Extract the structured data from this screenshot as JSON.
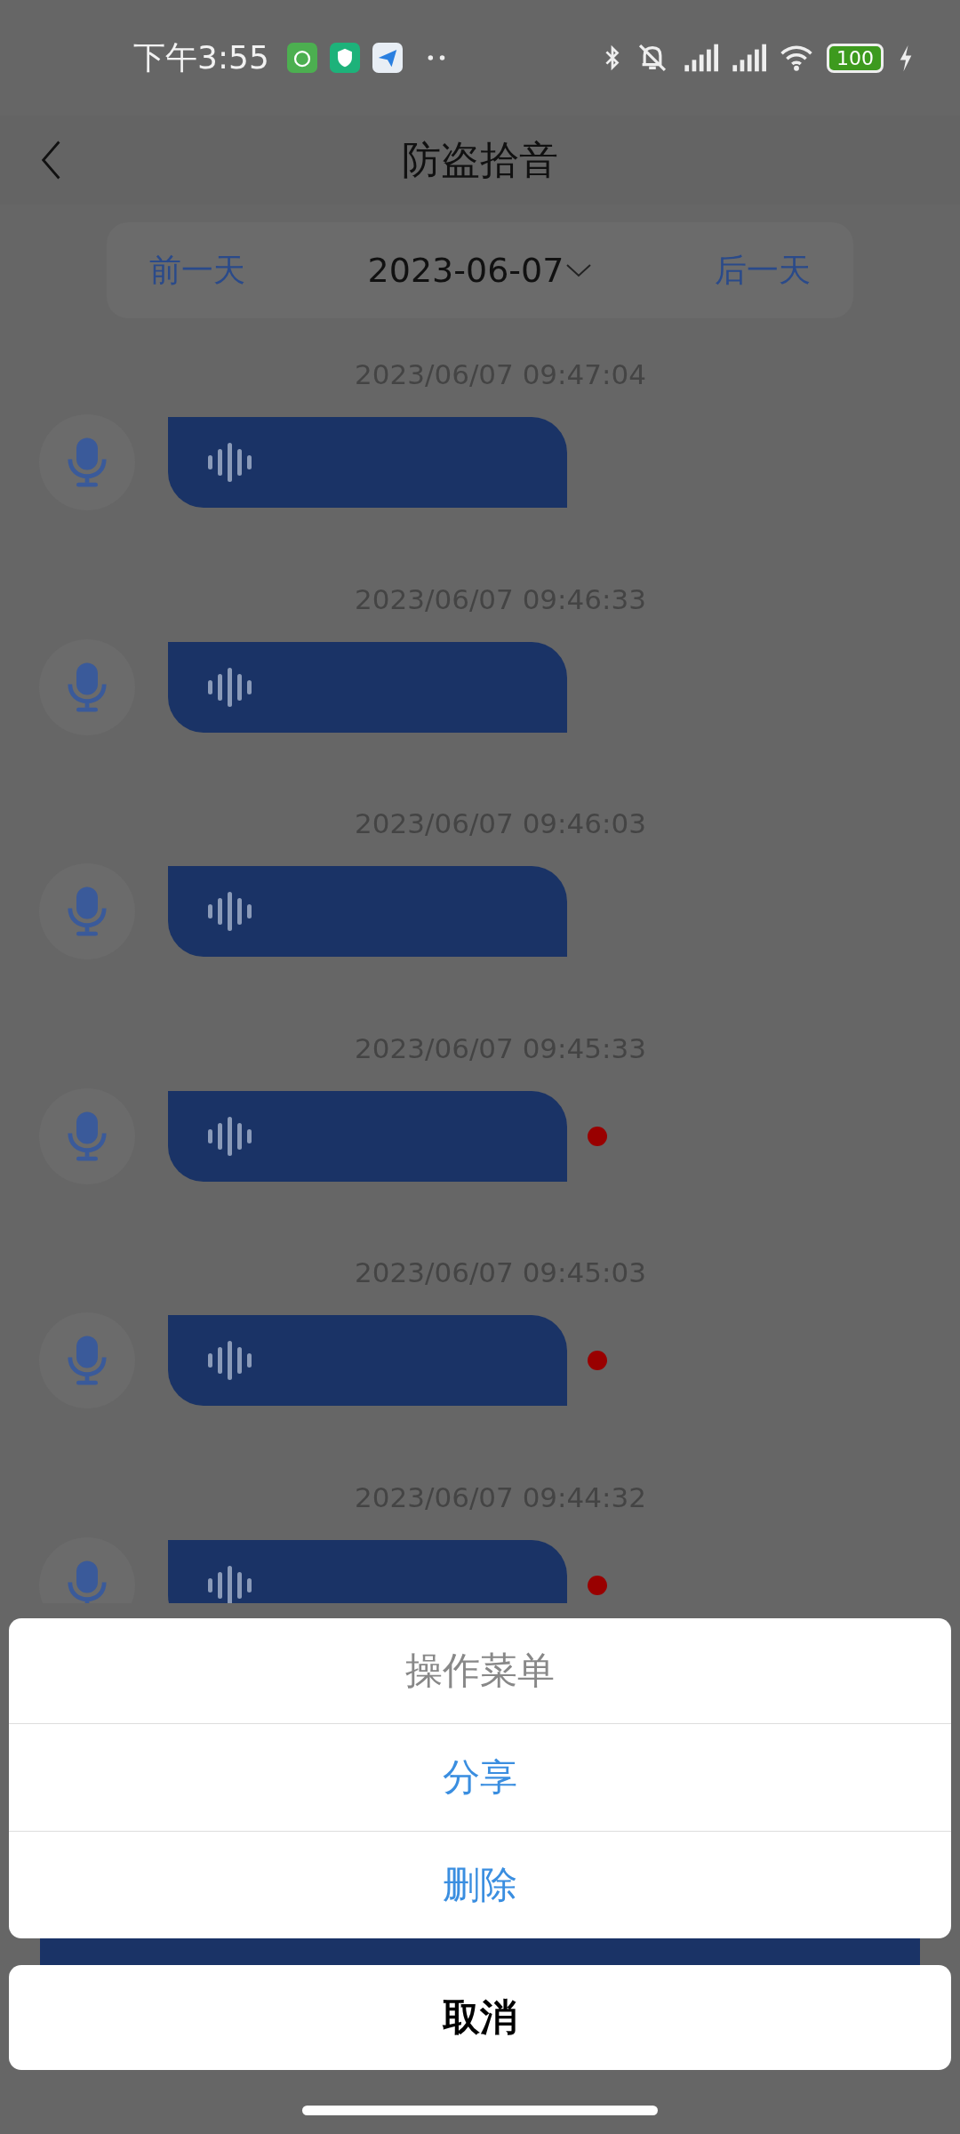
{
  "status_bar": {
    "time": "下午3:55",
    "battery": "100"
  },
  "header": {
    "title": "防盗拾音"
  },
  "date_nav": {
    "prev": "前一天",
    "date": "2023-06-07",
    "next": "后一天"
  },
  "recordings": [
    {
      "timestamp": "2023/06/07 09:47:04",
      "unread": false
    },
    {
      "timestamp": "2023/06/07 09:46:33",
      "unread": false
    },
    {
      "timestamp": "2023/06/07 09:46:03",
      "unread": false
    },
    {
      "timestamp": "2023/06/07 09:45:33",
      "unread": true
    },
    {
      "timestamp": "2023/06/07 09:45:03",
      "unread": true
    },
    {
      "timestamp": "2023/06/07 09:44:32",
      "unread": true
    }
  ],
  "action_sheet": {
    "title": "操作菜单",
    "items": [
      "分享",
      "删除"
    ],
    "cancel": "取消"
  }
}
